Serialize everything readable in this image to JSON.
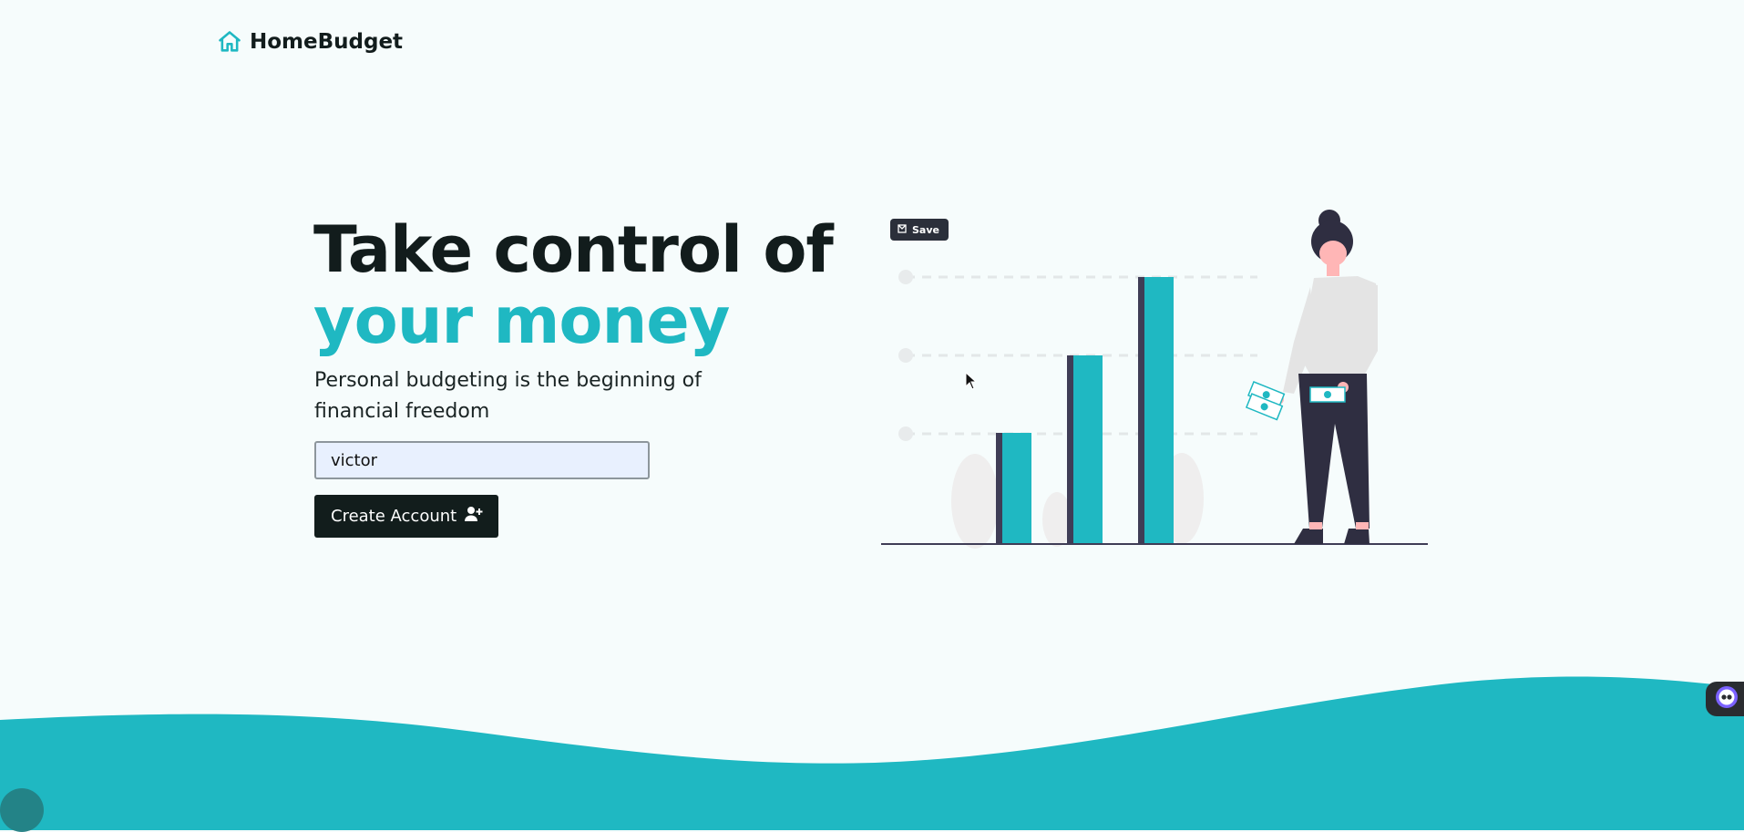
{
  "brand": {
    "name": "HomeBudget",
    "icon": "house-icon",
    "color": "#1fb8c2"
  },
  "hero": {
    "title_line1": "Take control of",
    "title_line2": "your money",
    "subtitle": "Personal budgeting is the beginning of financial freedom"
  },
  "form": {
    "name_value": "victor",
    "create_label": "Create Account",
    "create_icon": "user-plus-icon"
  },
  "illustration": {
    "save_label": "Save",
    "save_icon": "pinterest-save-icon"
  },
  "colors": {
    "accent": "#1fb8c2",
    "dark": "#121d1c",
    "background": "#f6fcfc"
  }
}
